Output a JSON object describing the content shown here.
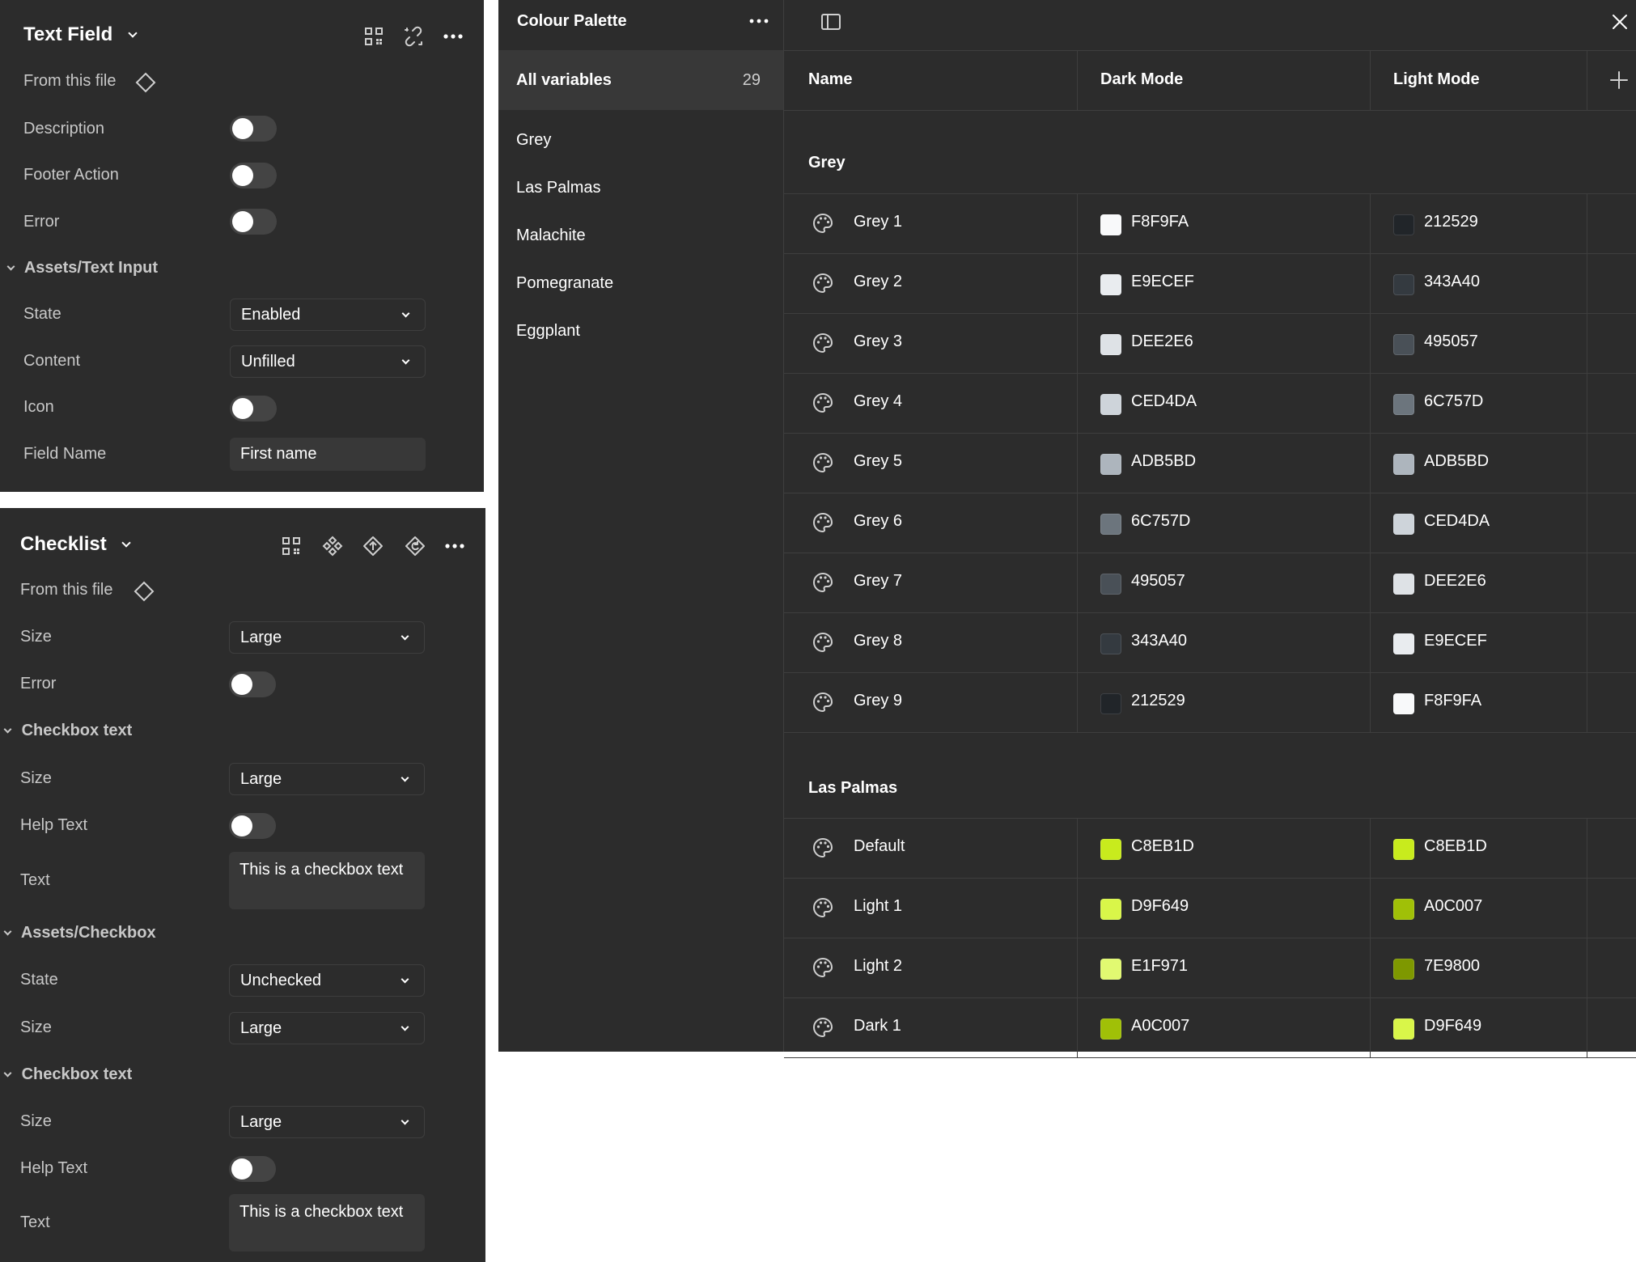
{
  "text_field_panel": {
    "title": "Text Field",
    "from_file": "From this file",
    "toggles": [
      {
        "label": "Description",
        "on": false
      },
      {
        "label": "Footer Action",
        "on": false
      },
      {
        "label": "Error",
        "on": false
      }
    ],
    "section": "Assets/Text Input",
    "state_label": "State",
    "state_value": "Enabled",
    "content_label": "Content",
    "content_value": "Unfilled",
    "icon_label": "Icon",
    "icon_on": false,
    "field_name_label": "Field Name",
    "field_name_value": "First name"
  },
  "checklist_panel": {
    "title": "Checklist",
    "from_file": "From this file",
    "size_label": "Size",
    "size_value": "Large",
    "error_label": "Error",
    "section1": "Checkbox text",
    "s1_size_label": "Size",
    "s1_size_value": "Large",
    "s1_help_label": "Help Text",
    "s1_text_label": "Text",
    "s1_text_value": "This is a checkbox text",
    "section2": "Assets/Checkbox",
    "s2_state_label": "State",
    "s2_state_value": "Unchecked",
    "s2_size_label": "Size",
    "s2_size_value": "Large",
    "section3": "Checkbox text",
    "s3_size_label": "Size",
    "s3_size_value": "Large",
    "s3_help_label": "Help Text",
    "s3_text_label": "Text",
    "s3_text_value": "This is a checkbox text"
  },
  "variables": {
    "collection_title": "Colour Palette",
    "all_variables_label": "All variables",
    "all_variables_count": "29",
    "groups_list": [
      "Grey",
      "Las Palmas",
      "Malachite",
      "Pomegranate",
      "Eggplant"
    ],
    "columns": {
      "name": "Name",
      "dark": "Dark Mode",
      "light": "Light Mode"
    },
    "group1": {
      "title": "Grey",
      "rows": [
        {
          "name": "Grey 1",
          "dark": "F8F9FA",
          "light": "212529"
        },
        {
          "name": "Grey 2",
          "dark": "E9ECEF",
          "light": "343A40"
        },
        {
          "name": "Grey 3",
          "dark": "DEE2E6",
          "light": "495057"
        },
        {
          "name": "Grey 4",
          "dark": "CED4DA",
          "light": "6C757D"
        },
        {
          "name": "Grey 5",
          "dark": "ADB5BD",
          "light": "ADB5BD"
        },
        {
          "name": "Grey 6",
          "dark": "6C757D",
          "light": "CED4DA"
        },
        {
          "name": "Grey 7",
          "dark": "495057",
          "light": "DEE2E6"
        },
        {
          "name": "Grey 8",
          "dark": "343A40",
          "light": "E9ECEF"
        },
        {
          "name": "Grey 9",
          "dark": "212529",
          "light": "F8F9FA"
        }
      ]
    },
    "group2": {
      "title": "Las Palmas",
      "rows": [
        {
          "name": "Default",
          "dark": "C8EB1D",
          "light": "C8EB1D"
        },
        {
          "name": "Light 1",
          "dark": "D9F649",
          "light": "A0C007"
        },
        {
          "name": "Light 2",
          "dark": "E1F971",
          "light": "7E9800"
        },
        {
          "name": "Dark 1",
          "dark": "A0C007",
          "light": "D9F649"
        }
      ]
    }
  }
}
